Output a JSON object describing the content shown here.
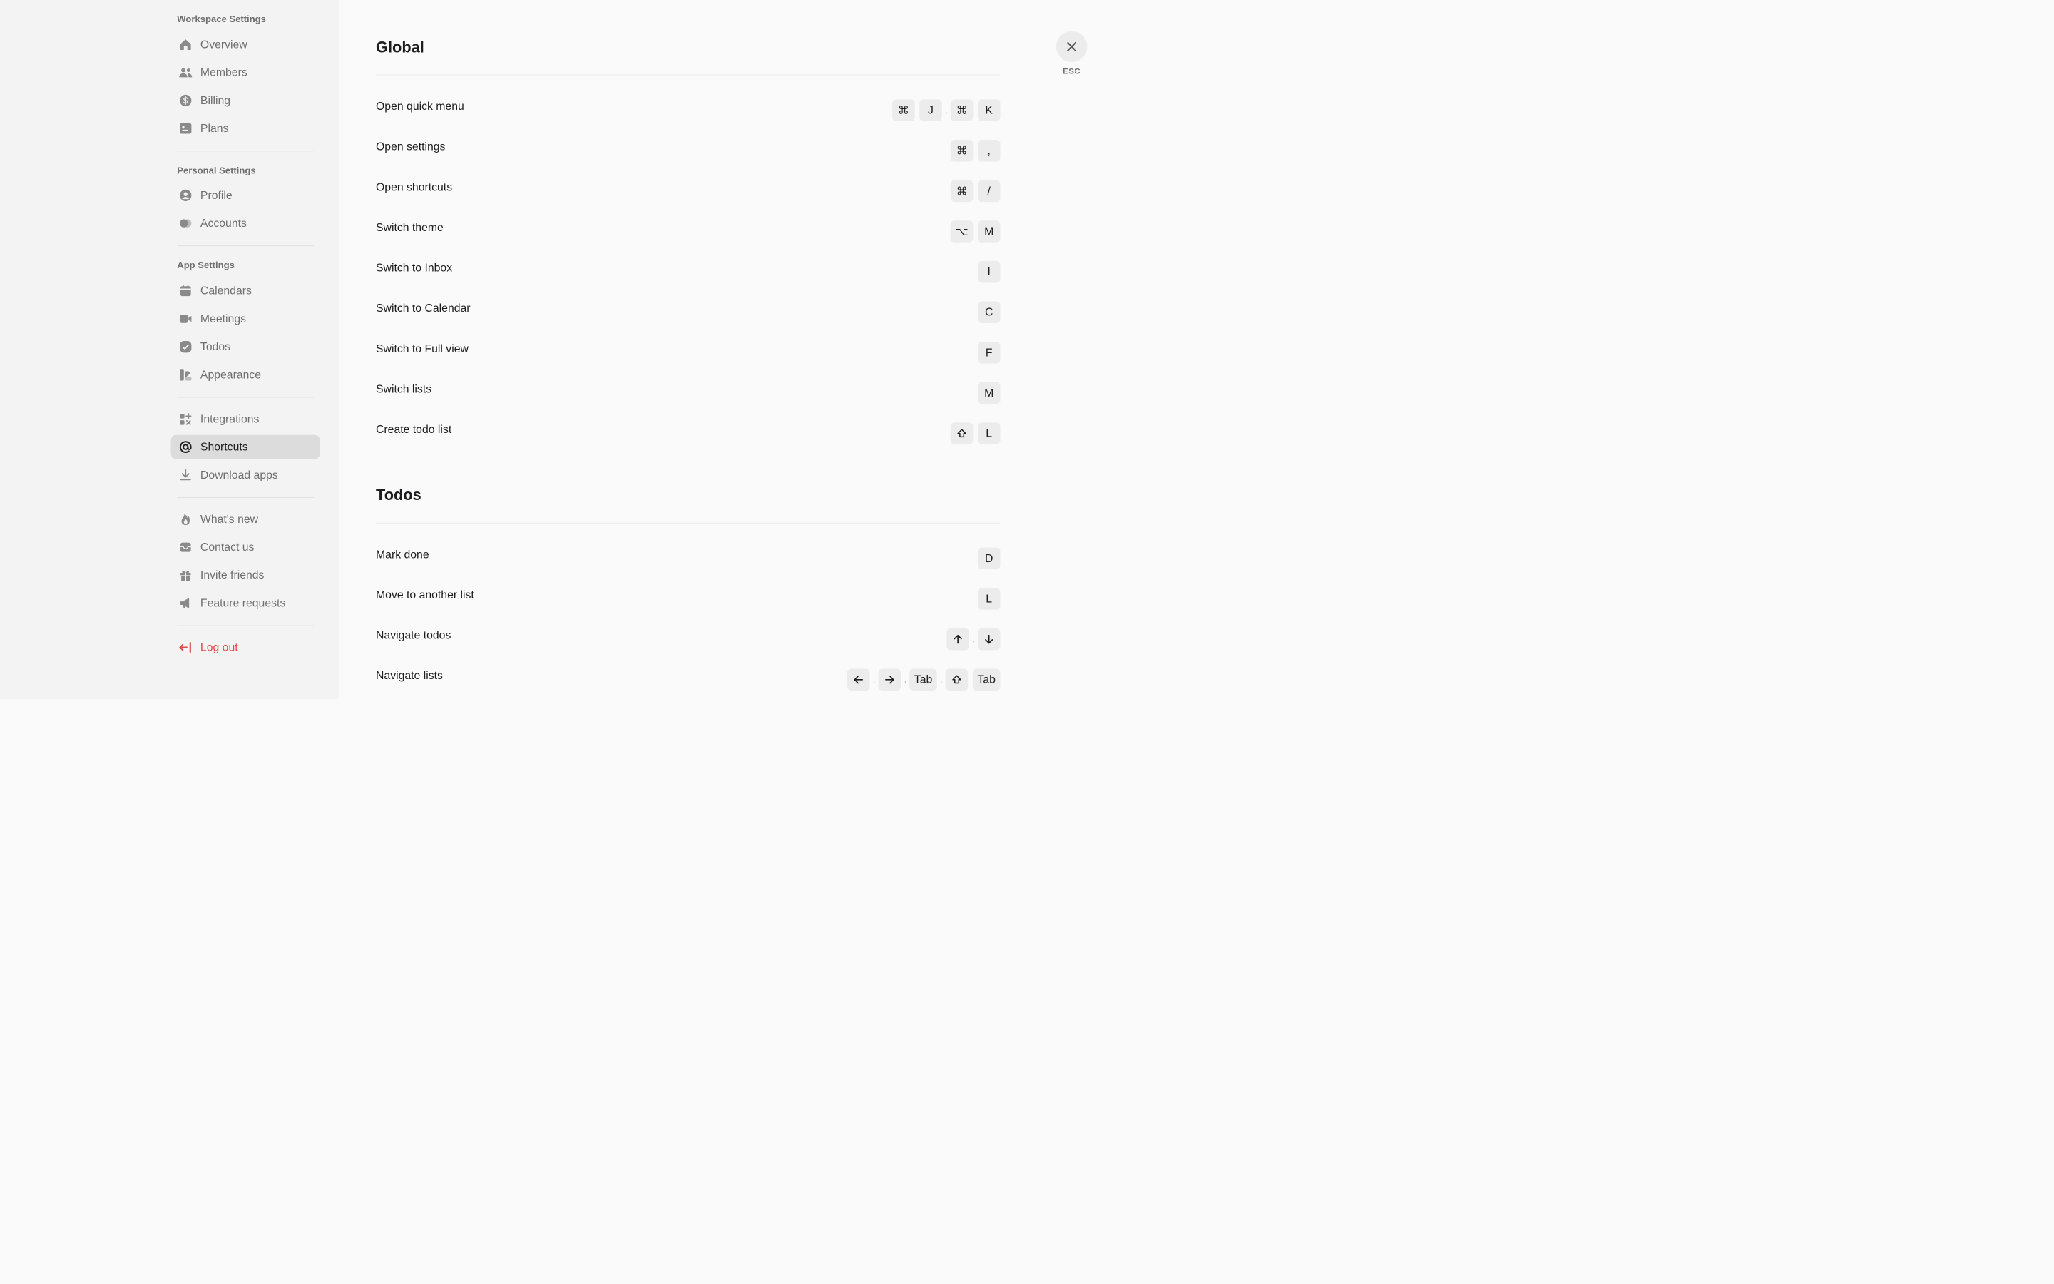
{
  "sidebar": {
    "sections": [
      {
        "title": "Workspace Settings",
        "items": [
          {
            "label": "Overview",
            "icon": "home-icon"
          },
          {
            "label": "Members",
            "icon": "members-icon"
          },
          {
            "label": "Billing",
            "icon": "dollar-icon"
          },
          {
            "label": "Plans",
            "icon": "plans-icon"
          }
        ]
      },
      {
        "title": "Personal Settings",
        "items": [
          {
            "label": "Profile",
            "icon": "profile-icon"
          },
          {
            "label": "Accounts",
            "icon": "accounts-icon"
          }
        ]
      },
      {
        "title": "App Settings",
        "items": [
          {
            "label": "Calendars",
            "icon": "calendar-icon"
          },
          {
            "label": "Meetings",
            "icon": "video-icon"
          },
          {
            "label": "Todos",
            "icon": "check-circle-icon"
          },
          {
            "label": "Appearance",
            "icon": "appearance-icon"
          }
        ]
      },
      {
        "title": "",
        "items": [
          {
            "label": "Integrations",
            "icon": "integrations-icon"
          },
          {
            "label": "Shortcuts",
            "icon": "at-icon",
            "active": true
          },
          {
            "label": "Download apps",
            "icon": "download-icon"
          }
        ]
      },
      {
        "title": "",
        "items": [
          {
            "label": "What's new",
            "icon": "flame-icon"
          },
          {
            "label": "Contact us",
            "icon": "inbox-icon"
          },
          {
            "label": "Invite friends",
            "icon": "gift-icon"
          },
          {
            "label": "Feature requests",
            "icon": "megaphone-icon"
          }
        ]
      },
      {
        "title": "",
        "items": [
          {
            "label": "Log out",
            "icon": "logout-icon",
            "danger": true
          }
        ]
      }
    ]
  },
  "close": {
    "label": "ESC",
    "icon": "close-icon"
  },
  "groups": [
    {
      "title": "Global",
      "rows": [
        {
          "label": "Open quick menu",
          "keys": [
            "⌘",
            "J",
            ",",
            "⌘",
            "K"
          ]
        },
        {
          "label": "Open settings",
          "keys": [
            "⌘",
            ","
          ]
        },
        {
          "label": "Open shortcuts",
          "keys": [
            "⌘",
            "/"
          ]
        },
        {
          "label": "Switch theme",
          "keys": [
            "⌥",
            "M"
          ]
        },
        {
          "label": "Switch to Inbox",
          "keys": [
            "I"
          ]
        },
        {
          "label": "Switch to Calendar",
          "keys": [
            "C"
          ]
        },
        {
          "label": "Switch to Full view",
          "keys": [
            "F"
          ]
        },
        {
          "label": "Switch lists",
          "keys": [
            "M"
          ]
        },
        {
          "label": "Create todo list",
          "keys": [
            "shift-icon",
            "L"
          ]
        }
      ]
    },
    {
      "title": "Todos",
      "rows": [
        {
          "label": "Mark done",
          "keys": [
            "D"
          ]
        },
        {
          "label": "Move to another list",
          "keys": [
            "L"
          ]
        },
        {
          "label": "Navigate todos",
          "keys": [
            "arrow-up-icon",
            ",",
            "arrow-down-icon"
          ]
        },
        {
          "label": "Navigate lists",
          "keys": [
            "arrow-left-icon",
            ",",
            "arrow-right-icon",
            ",",
            "Tab",
            ",",
            "shift-icon",
            "Tab"
          ]
        }
      ]
    }
  ],
  "colors": {
    "danger": "#e5484d",
    "muted": "#6f6f6f",
    "key_bg": "#ececec",
    "active_bg": "#dcdcdc"
  }
}
